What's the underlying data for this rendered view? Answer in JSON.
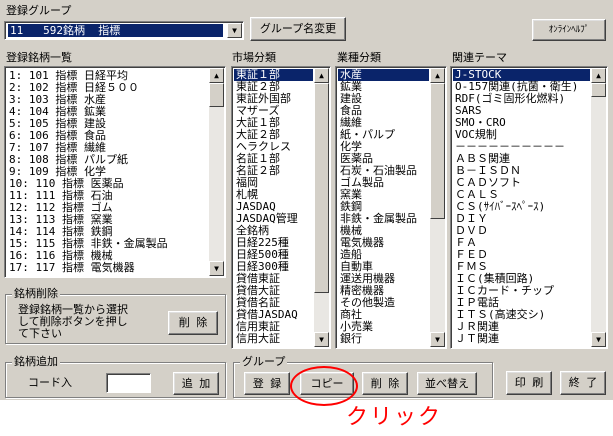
{
  "group_select": {
    "label": "登録グループ",
    "value": "11   592銘柄  指標",
    "change_name_button": "グループ名変更",
    "online_help_button": "ｵﾝﾗｲﾝﾍﾙﾌﾟ"
  },
  "stock_list": {
    "label": "登録銘柄一覧",
    "items": [
      "  1:   101 指標 日経平均",
      "  2:   102 指標 日経５００",
      "  3:   103 指標 水産",
      "  4:   104 指標 鉱業",
      "  5:   105 指標 建設",
      "  6:   106 指標 食品",
      "  7:   107 指標 繊維",
      "  8:   108 指標 パルプ紙",
      "  9:   109 指標 化学",
      " 10:   110 指標 医薬品",
      " 11:   111 指標 石油",
      " 12:   112 指標 ゴム",
      " 13:   113 指標 窯業",
      " 14:   114 指標 鉄鋼",
      " 15:   115 指標 非鉄・金属製品",
      " 16:   116 指標 機械",
      " 17:   117 指標 電気機器"
    ]
  },
  "market": {
    "label": "市場分類",
    "items": [
      "東証１部",
      "東証２部",
      "東証外国部",
      "マザーズ",
      "大証１部",
      "大証２部",
      "ヘラクレス",
      "名証１部",
      "名証２部",
      "福岡",
      "札幌",
      "JASDAQ",
      "JASDAQ管理",
      "全銘柄",
      "日経225種",
      "日経500種",
      "日経300種",
      "貸借東証",
      "貸借大証",
      "貸借名証",
      "貸借JASDAQ",
      "信用東証",
      "信用大証"
    ]
  },
  "industry": {
    "label": "業種分類",
    "items": [
      "水産",
      "鉱業",
      "建設",
      "食品",
      "繊維",
      "紙・パルプ",
      "化学",
      "医薬品",
      "石炭・石油製品",
      "ゴム製品",
      "窯業",
      "鉄鋼",
      "非鉄・金属製品",
      "機械",
      "電気機器",
      "造船",
      "自動車",
      "運送用機器",
      "精密機器",
      "その他製造",
      "商社",
      "小売業",
      "銀行"
    ]
  },
  "theme": {
    "label": "関連テーマ",
    "items": [
      "J-STOCK",
      "O-157関連(抗菌・衛生)",
      "RDF(ゴミ固形化燃料)",
      "SARS",
      "SMO・CRO",
      "VOC規制",
      "－－－－－－－－－－",
      "ＡＢＳ関連",
      "Ｂ－ＩＳＤＮ",
      "ＣＡＤソフト",
      "ＣＡＬＳ",
      "ＣＳ(ｻｲﾊﾞｰｽﾍﾟｰｽ)",
      "ＤＩＹ",
      "ＤＶＤ",
      "ＦＡ",
      "ＦＥＤ",
      "ＦＭＳ",
      "ＩＣ(集積回路)",
      "ＩＣカード・チップ",
      "ＩＰ電話",
      "ＩＴＳ(高速交シ)",
      "ＪＲ関連",
      "ＪＴ関連"
    ]
  },
  "delete_group": {
    "label": "銘柄削除",
    "text_lines": [
      "登録銘柄一覧から選択",
      "して削除ボタンを押し",
      "て下さい"
    ],
    "button": "削 除"
  },
  "add_group": {
    "label": "銘柄追加",
    "code_label": "コード入",
    "code_value": "",
    "button": "追 加"
  },
  "group_group": {
    "label": "グループ",
    "register": "登 録",
    "copy": "コピー",
    "delete": "削 除",
    "sort": "並べ替え"
  },
  "print_button": "印 刷",
  "exit_button": "終 了",
  "annotation": "クリック",
  "colors": {
    "face": "#d4d0c8",
    "selection": "#0a246a",
    "annotation": "#ff0000"
  }
}
